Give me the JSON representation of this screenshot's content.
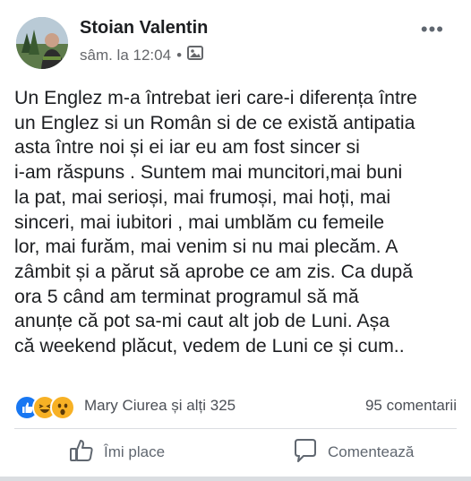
{
  "post": {
    "author": "Stoian Valentin",
    "timestamp": "sâm. la 12:04",
    "separator": "•",
    "audience_icon": "photo-icon",
    "more_icon": "more-dots-icon",
    "more_label": "•••",
    "text_lines": [
      "Un Englez m-a întrebat ieri care-i diferența între",
      "un Englez si un Român si de ce există antipatia",
      "asta între noi și ei iar eu am fost sincer si",
      "i-am răspuns . Suntem mai muncitori,mai buni",
      "la pat, mai serioși, mai frumoși, mai hoți, mai",
      "sinceri, mai iubitori , mai umblăm cu femeile",
      "lor, mai furăm, mai venim si nu mai plecăm. A",
      "zâmbit și a părut să aprobe ce am zis. Ca după",
      "ora 5 când am terminat programul să mă",
      "anunțe că pot sa-mi caut alt job de Luni.  Așa",
      "că weekend plăcut, vedem de Luni ce și cum.."
    ]
  },
  "reactions": {
    "icons": [
      "like-reaction-icon",
      "haha-reaction-icon",
      "wow-reaction-icon"
    ],
    "names": "Mary Ciurea și alți 325",
    "comments": "95 comentarii"
  },
  "actions": {
    "like_label": "Îmi place",
    "comment_label": "Comentează"
  },
  "colors": {
    "text": "#1c1e21",
    "secondary": "#65676b",
    "like_blue": "#1877f2",
    "emoji_yellow": "#f7b125"
  }
}
